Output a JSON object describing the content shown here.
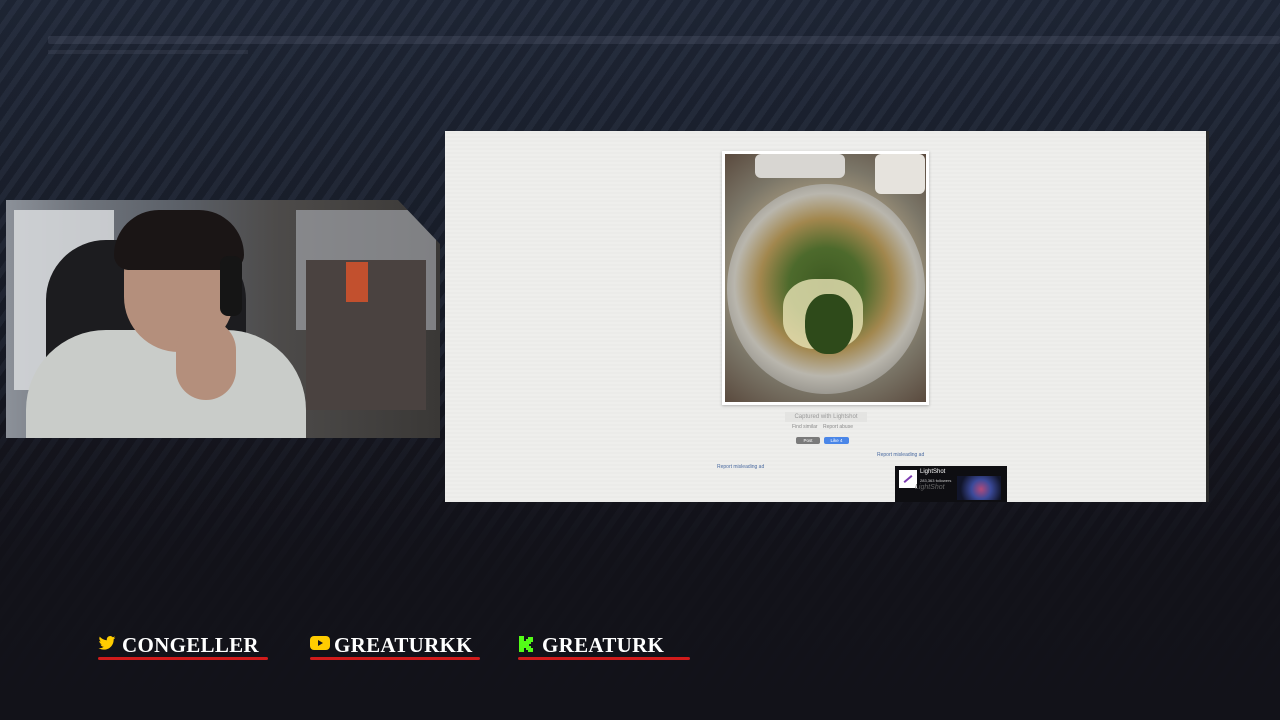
{
  "browser": {
    "caption": "Captured with Lightshot",
    "links": [
      "Find similar",
      "Report abuse"
    ],
    "post_label": "Post",
    "like_label": "Like 4",
    "report_ad_1": "Report misleading ad",
    "report_ad_2": "Report misleading ad",
    "ad": {
      "name": "LightShot",
      "followers": "283,363 followers",
      "brand": "LightShot"
    }
  },
  "socials": [
    {
      "platform": "twitter-icon",
      "handle": "CONGELLER",
      "color": "#1DA1F2"
    },
    {
      "platform": "youtube-icon",
      "handle": "GREATURKK",
      "color": "#FFCC00"
    },
    {
      "platform": "kick-icon",
      "handle": "GREATURK",
      "color": "#53FC18"
    }
  ],
  "colors": {
    "underline": "#d11b1b",
    "background": "#14141d"
  }
}
